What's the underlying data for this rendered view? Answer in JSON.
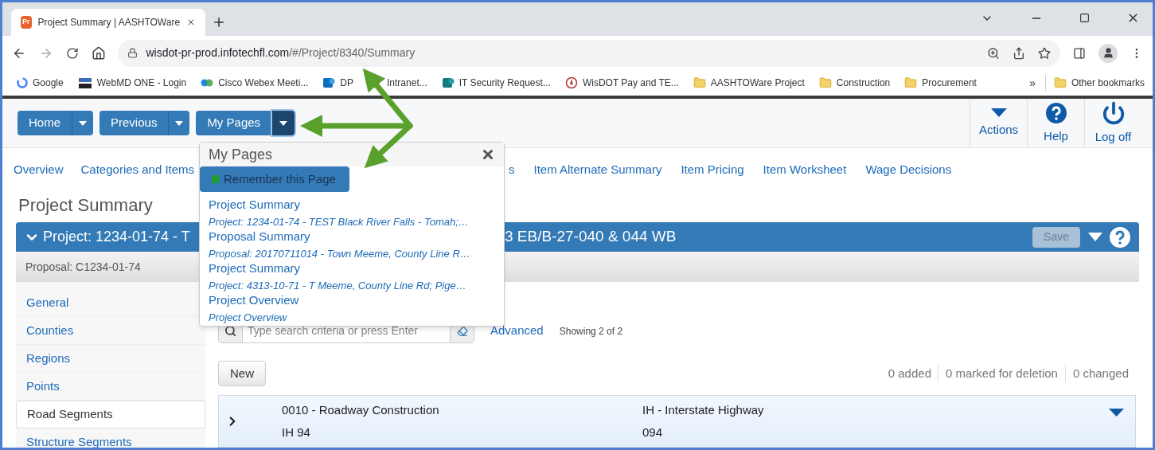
{
  "browser": {
    "tab": {
      "icon_text": "Pr",
      "title": "Project Summary | AASHTOWare"
    },
    "url": {
      "host": "wisdot-pr-prod.infotechfl.com",
      "path": "/#/Project/8340/Summary"
    },
    "bookmarks": [
      {
        "label": "Google",
        "kind": "google"
      },
      {
        "label": "WebMD ONE - Login",
        "kind": "webmd"
      },
      {
        "label": "Cisco Webex Meeti...",
        "kind": "webex"
      },
      {
        "label": "DP",
        "label_end": "Intranet...",
        "kind": "sharepoint"
      },
      {
        "label": "IT Security Request...",
        "kind": "sharepoint2"
      },
      {
        "label": "WisDOT Pay and TE...",
        "kind": "wisdot"
      },
      {
        "label": "AASHTOWare Project",
        "kind": "folder"
      },
      {
        "label": "Construction",
        "kind": "folder"
      },
      {
        "label": "Procurement",
        "kind": "folder"
      }
    ],
    "more_bookmarks": "»",
    "other_bookmarks": "Other bookmarks"
  },
  "nav_buttons": [
    {
      "label": "Home",
      "expanded": false
    },
    {
      "label": "Previous",
      "expanded": false
    },
    {
      "label": "My Pages",
      "expanded": true
    }
  ],
  "actions": [
    {
      "label": "Actions",
      "kind": "caret"
    },
    {
      "label": "Help",
      "kind": "help"
    },
    {
      "label": "Log off",
      "kind": "power"
    }
  ],
  "tabs_before_menu": [
    "Overview",
    "Categories and Items"
  ],
  "tabs_after_menu": [
    "s",
    "Item Alternate Summary",
    "Item Pricing",
    "Item Worksheet",
    "Wage Decisions"
  ],
  "page_title": "Project Summary",
  "project_header": {
    "text_start": "Project: 1234-01-74 - T",
    "text_end": "3 EB/B-27-040 & 044 WB",
    "save": {
      "label": "Save",
      "disabled": true
    }
  },
  "proposal": "Proposal: C1234-01-74",
  "sidebar": [
    {
      "label": "General",
      "selected": false
    },
    {
      "label": "Counties",
      "selected": false
    },
    {
      "label": "Regions",
      "selected": false
    },
    {
      "label": "Points",
      "selected": false
    },
    {
      "label": "Road Segments",
      "selected": true
    },
    {
      "label": "Structure Segments",
      "selected": false
    }
  ],
  "search": {
    "placeholder": "Type search criteria or press Enter"
  },
  "advanced": "Advanced",
  "showing": "Showing 2 of 2",
  "new_button": "New",
  "counters": [
    "0 added",
    "0 marked for deletion",
    "0 changed"
  ],
  "rows": [
    {
      "expanded": false,
      "cells": [
        {
          "line1": "0010 - Roadway Construction",
          "line2": "IH 94"
        },
        {
          "line1": "IH - Interstate Highway",
          "line2": "094"
        }
      ]
    }
  ],
  "menu": {
    "title": "My Pages",
    "remember": "Remember this Page",
    "items": [
      {
        "title": "Project Summary",
        "subtitle": "Project: 1234-01-74 - TEST Black River Falls - Tomah;…"
      },
      {
        "title": "Proposal Summary",
        "subtitle": "Proposal: 20170711014 - Town Meeme, County Line R…"
      },
      {
        "title": "Project Summary",
        "subtitle": "Project: 4313-10-71 - T Meeme, County Line Rd; Pige…"
      },
      {
        "title": "Project Overview",
        "subtitle": "Project Overview"
      }
    ]
  }
}
